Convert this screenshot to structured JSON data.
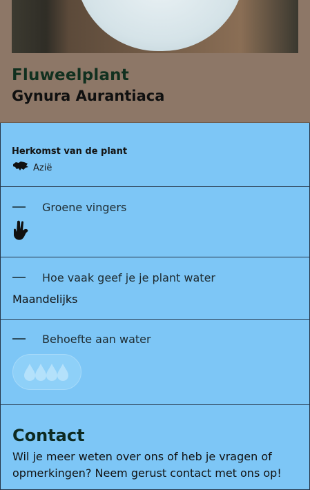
{
  "plant": {
    "name": "Fluweelplant",
    "latin_name": "Gynura Aurantiaca"
  },
  "origin": {
    "label": "Herkomst van de plant",
    "region": "Azië",
    "icon": "asia-map-icon"
  },
  "care": [
    {
      "title": "Groene vingers",
      "icon": "hand-icon"
    },
    {
      "title": "Hoe vaak geef je je plant water",
      "value": "Maandelijks"
    },
    {
      "title": "Behoefte aan water",
      "icon": "water-drops-icon",
      "level": 4
    }
  ],
  "contact": {
    "title": "Contact",
    "text": "Wil je meer weten over ons of heb je vragen of opmerkingen? Neem gerust contact met ons op!"
  },
  "colors": {
    "hero_bg": "#8d7767",
    "panel_bg": "#7dc6f6",
    "title_green": "#11301f"
  }
}
